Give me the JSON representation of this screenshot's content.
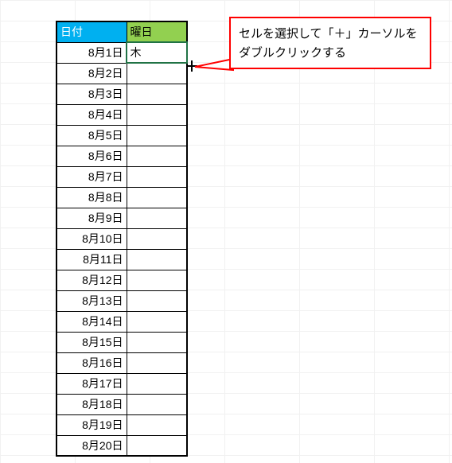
{
  "headers": {
    "date": "日付",
    "day": "曜日"
  },
  "rows": [
    {
      "date": "8月1日",
      "day": "木"
    },
    {
      "date": "8月2日",
      "day": ""
    },
    {
      "date": "8月3日",
      "day": ""
    },
    {
      "date": "8月4日",
      "day": ""
    },
    {
      "date": "8月5日",
      "day": ""
    },
    {
      "date": "8月6日",
      "day": ""
    },
    {
      "date": "8月7日",
      "day": ""
    },
    {
      "date": "8月8日",
      "day": ""
    },
    {
      "date": "8月9日",
      "day": ""
    },
    {
      "date": "8月10日",
      "day": ""
    },
    {
      "date": "8月11日",
      "day": ""
    },
    {
      "date": "8月12日",
      "day": ""
    },
    {
      "date": "8月13日",
      "day": ""
    },
    {
      "date": "8月14日",
      "day": ""
    },
    {
      "date": "8月15日",
      "day": ""
    },
    {
      "date": "8月16日",
      "day": ""
    },
    {
      "date": "8月17日",
      "day": ""
    },
    {
      "date": "8月18日",
      "day": ""
    },
    {
      "date": "8月19日",
      "day": ""
    },
    {
      "date": "8月20日",
      "day": ""
    }
  ],
  "callout": {
    "line1": "セルを選択して「＋」カーソルを",
    "line2": "ダブルクリックする"
  }
}
